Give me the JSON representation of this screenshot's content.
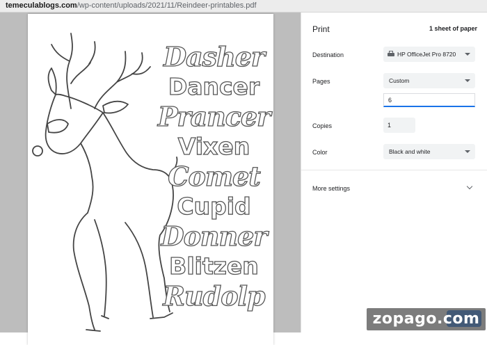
{
  "browser": {
    "url_host": "temeculablogs.com",
    "url_path": "/wp-content/uploads/2021/11/Reindeer-printables.pdf"
  },
  "preview": {
    "reindeer_names": [
      "Dasher",
      "Dancer",
      "Prancer",
      "Vixen",
      "Comet",
      "Cupid",
      "Donner",
      "Blitzen",
      "Rudolp"
    ]
  },
  "print_panel": {
    "title": "Print",
    "sheet_count": "1 sheet of paper",
    "destination_label": "Destination",
    "destination_value": "HP OfficeJet Pro 8720",
    "destination_icon": "printer-icon",
    "pages_label": "Pages",
    "pages_value": "Custom",
    "pages_custom_value": "6",
    "copies_label": "Copies",
    "copies_value": "1",
    "color_label": "Color",
    "color_value": "Black and white",
    "more_settings_label": "More settings"
  },
  "watermark": "zopago.com",
  "colors": {
    "accent": "#1a73e8",
    "preview_bg": "#bdbdbd",
    "control_bg": "#f1f3f4"
  }
}
